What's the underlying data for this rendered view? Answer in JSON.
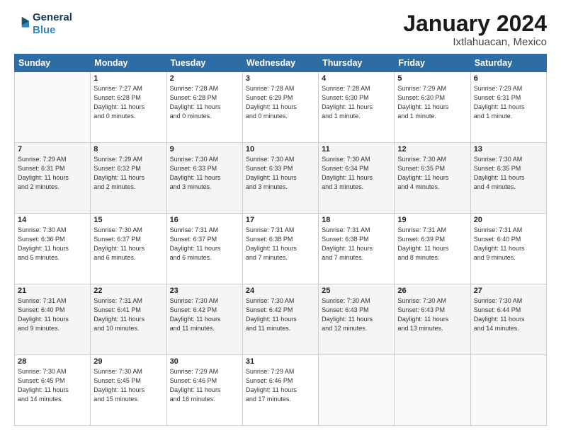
{
  "logo": {
    "line1": "General",
    "line2": "Blue"
  },
  "title": "January 2024",
  "location": "Ixtlahuacan, Mexico",
  "days_of_week": [
    "Sunday",
    "Monday",
    "Tuesday",
    "Wednesday",
    "Thursday",
    "Friday",
    "Saturday"
  ],
  "weeks": [
    [
      {
        "day": "",
        "sunrise": "",
        "sunset": "",
        "daylight": ""
      },
      {
        "day": "1",
        "sunrise": "Sunrise: 7:27 AM",
        "sunset": "Sunset: 6:28 PM",
        "daylight": "Daylight: 11 hours and 0 minutes."
      },
      {
        "day": "2",
        "sunrise": "Sunrise: 7:28 AM",
        "sunset": "Sunset: 6:28 PM",
        "daylight": "Daylight: 11 hours and 0 minutes."
      },
      {
        "day": "3",
        "sunrise": "Sunrise: 7:28 AM",
        "sunset": "Sunset: 6:29 PM",
        "daylight": "Daylight: 11 hours and 0 minutes."
      },
      {
        "day": "4",
        "sunrise": "Sunrise: 7:28 AM",
        "sunset": "Sunset: 6:30 PM",
        "daylight": "Daylight: 11 hours and 1 minute."
      },
      {
        "day": "5",
        "sunrise": "Sunrise: 7:29 AM",
        "sunset": "Sunset: 6:30 PM",
        "daylight": "Daylight: 11 hours and 1 minute."
      },
      {
        "day": "6",
        "sunrise": "Sunrise: 7:29 AM",
        "sunset": "Sunset: 6:31 PM",
        "daylight": "Daylight: 11 hours and 1 minute."
      }
    ],
    [
      {
        "day": "7",
        "sunrise": "Sunrise: 7:29 AM",
        "sunset": "Sunset: 6:31 PM",
        "daylight": "Daylight: 11 hours and 2 minutes."
      },
      {
        "day": "8",
        "sunrise": "Sunrise: 7:29 AM",
        "sunset": "Sunset: 6:32 PM",
        "daylight": "Daylight: 11 hours and 2 minutes."
      },
      {
        "day": "9",
        "sunrise": "Sunrise: 7:30 AM",
        "sunset": "Sunset: 6:33 PM",
        "daylight": "Daylight: 11 hours and 3 minutes."
      },
      {
        "day": "10",
        "sunrise": "Sunrise: 7:30 AM",
        "sunset": "Sunset: 6:33 PM",
        "daylight": "Daylight: 11 hours and 3 minutes."
      },
      {
        "day": "11",
        "sunrise": "Sunrise: 7:30 AM",
        "sunset": "Sunset: 6:34 PM",
        "daylight": "Daylight: 11 hours and 3 minutes."
      },
      {
        "day": "12",
        "sunrise": "Sunrise: 7:30 AM",
        "sunset": "Sunset: 6:35 PM",
        "daylight": "Daylight: 11 hours and 4 minutes."
      },
      {
        "day": "13",
        "sunrise": "Sunrise: 7:30 AM",
        "sunset": "Sunset: 6:35 PM",
        "daylight": "Daylight: 11 hours and 4 minutes."
      }
    ],
    [
      {
        "day": "14",
        "sunrise": "Sunrise: 7:30 AM",
        "sunset": "Sunset: 6:36 PM",
        "daylight": "Daylight: 11 hours and 5 minutes."
      },
      {
        "day": "15",
        "sunrise": "Sunrise: 7:30 AM",
        "sunset": "Sunset: 6:37 PM",
        "daylight": "Daylight: 11 hours and 6 minutes."
      },
      {
        "day": "16",
        "sunrise": "Sunrise: 7:31 AM",
        "sunset": "Sunset: 6:37 PM",
        "daylight": "Daylight: 11 hours and 6 minutes."
      },
      {
        "day": "17",
        "sunrise": "Sunrise: 7:31 AM",
        "sunset": "Sunset: 6:38 PM",
        "daylight": "Daylight: 11 hours and 7 minutes."
      },
      {
        "day": "18",
        "sunrise": "Sunrise: 7:31 AM",
        "sunset": "Sunset: 6:38 PM",
        "daylight": "Daylight: 11 hours and 7 minutes."
      },
      {
        "day": "19",
        "sunrise": "Sunrise: 7:31 AM",
        "sunset": "Sunset: 6:39 PM",
        "daylight": "Daylight: 11 hours and 8 minutes."
      },
      {
        "day": "20",
        "sunrise": "Sunrise: 7:31 AM",
        "sunset": "Sunset: 6:40 PM",
        "daylight": "Daylight: 11 hours and 9 minutes."
      }
    ],
    [
      {
        "day": "21",
        "sunrise": "Sunrise: 7:31 AM",
        "sunset": "Sunset: 6:40 PM",
        "daylight": "Daylight: 11 hours and 9 minutes."
      },
      {
        "day": "22",
        "sunrise": "Sunrise: 7:31 AM",
        "sunset": "Sunset: 6:41 PM",
        "daylight": "Daylight: 11 hours and 10 minutes."
      },
      {
        "day": "23",
        "sunrise": "Sunrise: 7:30 AM",
        "sunset": "Sunset: 6:42 PM",
        "daylight": "Daylight: 11 hours and 11 minutes."
      },
      {
        "day": "24",
        "sunrise": "Sunrise: 7:30 AM",
        "sunset": "Sunset: 6:42 PM",
        "daylight": "Daylight: 11 hours and 11 minutes."
      },
      {
        "day": "25",
        "sunrise": "Sunrise: 7:30 AM",
        "sunset": "Sunset: 6:43 PM",
        "daylight": "Daylight: 11 hours and 12 minutes."
      },
      {
        "day": "26",
        "sunrise": "Sunrise: 7:30 AM",
        "sunset": "Sunset: 6:43 PM",
        "daylight": "Daylight: 11 hours and 13 minutes."
      },
      {
        "day": "27",
        "sunrise": "Sunrise: 7:30 AM",
        "sunset": "Sunset: 6:44 PM",
        "daylight": "Daylight: 11 hours and 14 minutes."
      }
    ],
    [
      {
        "day": "28",
        "sunrise": "Sunrise: 7:30 AM",
        "sunset": "Sunset: 6:45 PM",
        "daylight": "Daylight: 11 hours and 14 minutes."
      },
      {
        "day": "29",
        "sunrise": "Sunrise: 7:30 AM",
        "sunset": "Sunset: 6:45 PM",
        "daylight": "Daylight: 11 hours and 15 minutes."
      },
      {
        "day": "30",
        "sunrise": "Sunrise: 7:29 AM",
        "sunset": "Sunset: 6:46 PM",
        "daylight": "Daylight: 11 hours and 16 minutes."
      },
      {
        "day": "31",
        "sunrise": "Sunrise: 7:29 AM",
        "sunset": "Sunset: 6:46 PM",
        "daylight": "Daylight: 11 hours and 17 minutes."
      },
      {
        "day": "",
        "sunrise": "",
        "sunset": "",
        "daylight": ""
      },
      {
        "day": "",
        "sunrise": "",
        "sunset": "",
        "daylight": ""
      },
      {
        "day": "",
        "sunrise": "",
        "sunset": "",
        "daylight": ""
      }
    ]
  ]
}
